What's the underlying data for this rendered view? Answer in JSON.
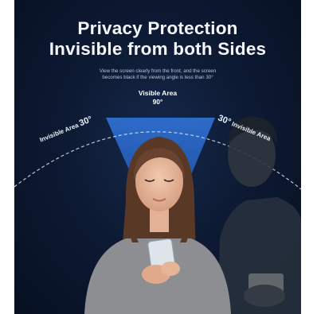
{
  "title": {
    "line1": "Privacy Protection",
    "line2": "Invisible from both Sides"
  },
  "subtitle": {
    "line1": "View the screen clearly from the front, and the screen",
    "line2": "becomes black if the viewing angle is less than 30°"
  },
  "visible_area": {
    "label": "Visible Area",
    "angle": "90°"
  },
  "left_zone": {
    "label": "Invisible Area",
    "angle": "30°"
  },
  "right_zone": {
    "label": "Invisible Area",
    "angle": "30°"
  },
  "colors": {
    "background": "#0d1a33",
    "cone": "#2f6fd0",
    "text": "#f4f6fb"
  }
}
